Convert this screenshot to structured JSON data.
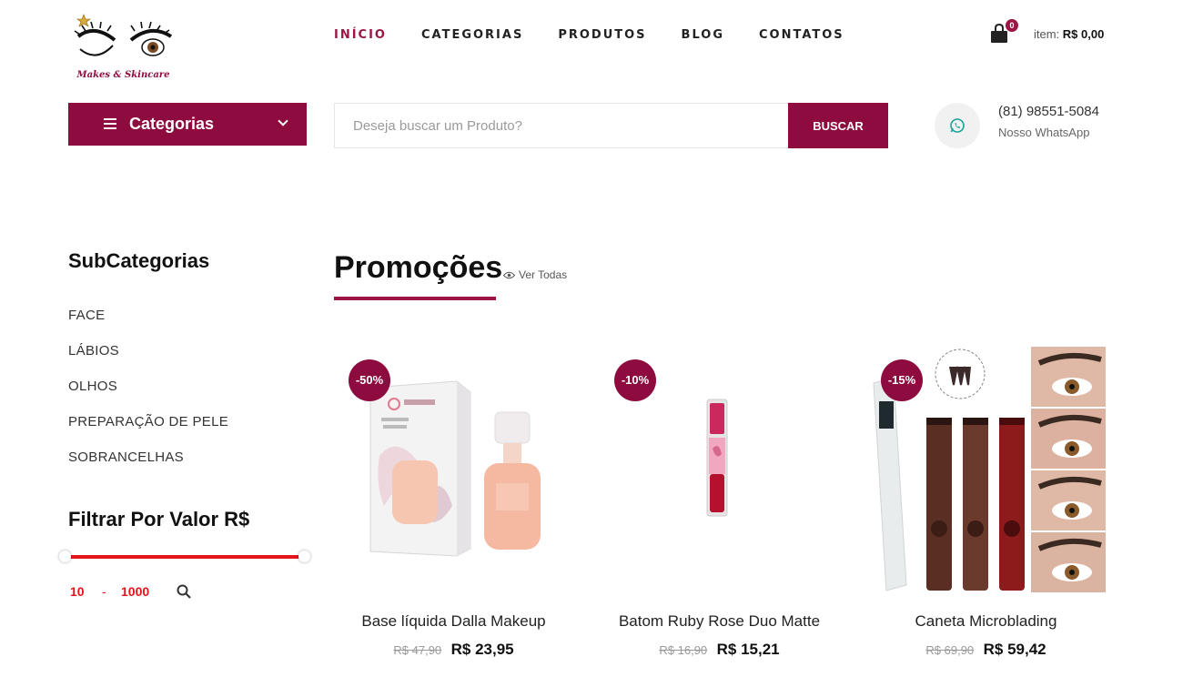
{
  "brand": {
    "logo_text": "Makes & Skincare"
  },
  "nav": {
    "items": [
      "INÍCIO",
      "CATEGORIAS",
      "PRODUTOS",
      "BLOG",
      "CONTATOS"
    ]
  },
  "cart": {
    "count": "0",
    "label": "item:",
    "total": "R$ 0,00"
  },
  "categories_button": {
    "label": "Categorias"
  },
  "search": {
    "placeholder": "Deseja buscar um Produto?",
    "button": "BUSCAR"
  },
  "whatsapp": {
    "phone": "(81) 98551-5084",
    "label": "Nosso WhatsApp"
  },
  "sidebar": {
    "subcategories_title": "SubCategorias",
    "subcategories": [
      "FACE",
      "LÁBIOS",
      "OLHOS",
      "PREPARAÇÃO DE PELE",
      "SOBRANCELHAS"
    ],
    "filter_title": "Filtrar Por Valor R$",
    "price_min": "10",
    "price_sep": "-",
    "price_max": "1000"
  },
  "promotions": {
    "title": "Promoções",
    "see_all": "Ver Todas",
    "products": [
      {
        "name": "Base líquida Dalla Makeup",
        "discount": "-50%",
        "old_price": "R$ 47,90",
        "price": "R$ 23,95"
      },
      {
        "name": "Batom Ruby Rose Duo Matte",
        "discount": "-10%",
        "old_price": "R$ 16,90",
        "price": "R$ 15,21"
      },
      {
        "name": "Caneta Microblading",
        "discount": "-15%",
        "old_price": "R$ 69,90",
        "price": "R$ 59,42"
      }
    ]
  },
  "colors": {
    "accent": "#8d0b3f",
    "active_nav": "#9b1645",
    "slider": "#e4141c"
  }
}
